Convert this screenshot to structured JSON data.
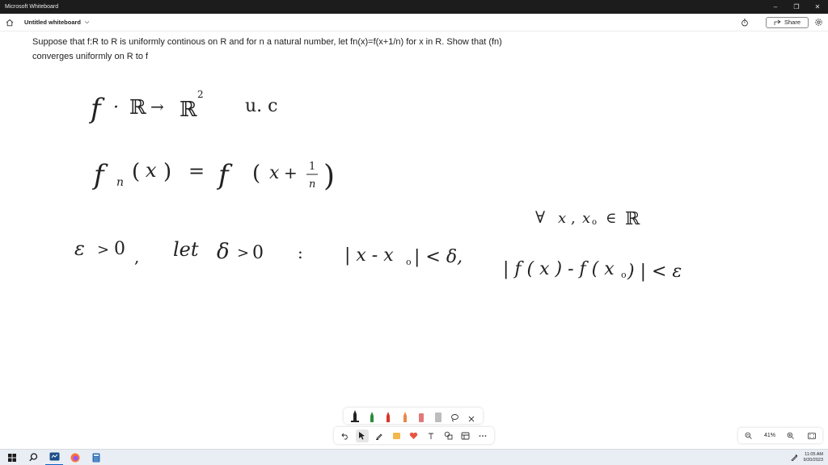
{
  "window": {
    "title": "Microsoft Whiteboard",
    "minimize": "–",
    "restore": "❐",
    "close": "✕"
  },
  "header": {
    "board_name": "Untitled whiteboard",
    "chevron": "⌵",
    "share_label": "Share"
  },
  "problem_text": "Suppose that f:R to R is uniformly continous on R and for n a natural number, let fn(x)=f(x+1/n) for x in R. Show that (fn) converges uniformly on R to f",
  "ink_strokes": {
    "line1": {
      "f": "f",
      "colon": "·",
      "R": "ℝ",
      "arrow": "→",
      "R2": "ℝ",
      "sup": "2",
      "uc": "u. c"
    },
    "line2": {
      "fn": "f",
      "n": "n",
      "lp1": "(",
      "x": "x",
      "rp1": ")",
      "eq": "=",
      "f": "f",
      "lp2": "(",
      "x2": "x",
      "plus": "+",
      "one": "1",
      "nn": "n",
      "rp2": ")"
    },
    "line3": {
      "forall": "∀",
      "x": "x",
      "comma": ",",
      "x0": "x",
      "zero": "o",
      "in": "∈",
      "R": "ℝ"
    },
    "line4": {
      "eps": "ε",
      "gt": ">",
      "zero": "0",
      "comma1": ",",
      "let": "let",
      "delta": "δ",
      "gt2": ">",
      "zero2": "0",
      "colon": ":",
      "abs1": "| x - x",
      "sub0": "o",
      "abs1end": "| <  δ,",
      "abs2": "| f ( x ) - f ( x",
      "sub02": "o",
      "abs2end": ") |  <  ε"
    }
  },
  "zoom": {
    "level": "41%"
  },
  "taskbar": {
    "time": "11:05 AM",
    "date": "9/20/2023"
  },
  "colors": {
    "pen_black": "#222222",
    "pen_green": "#2e8b3a",
    "pen_red": "#d9352b",
    "pen_orange": "#e8884a",
    "pen_pink": "#e07a7a",
    "highlighter": "#bdbdbd"
  }
}
